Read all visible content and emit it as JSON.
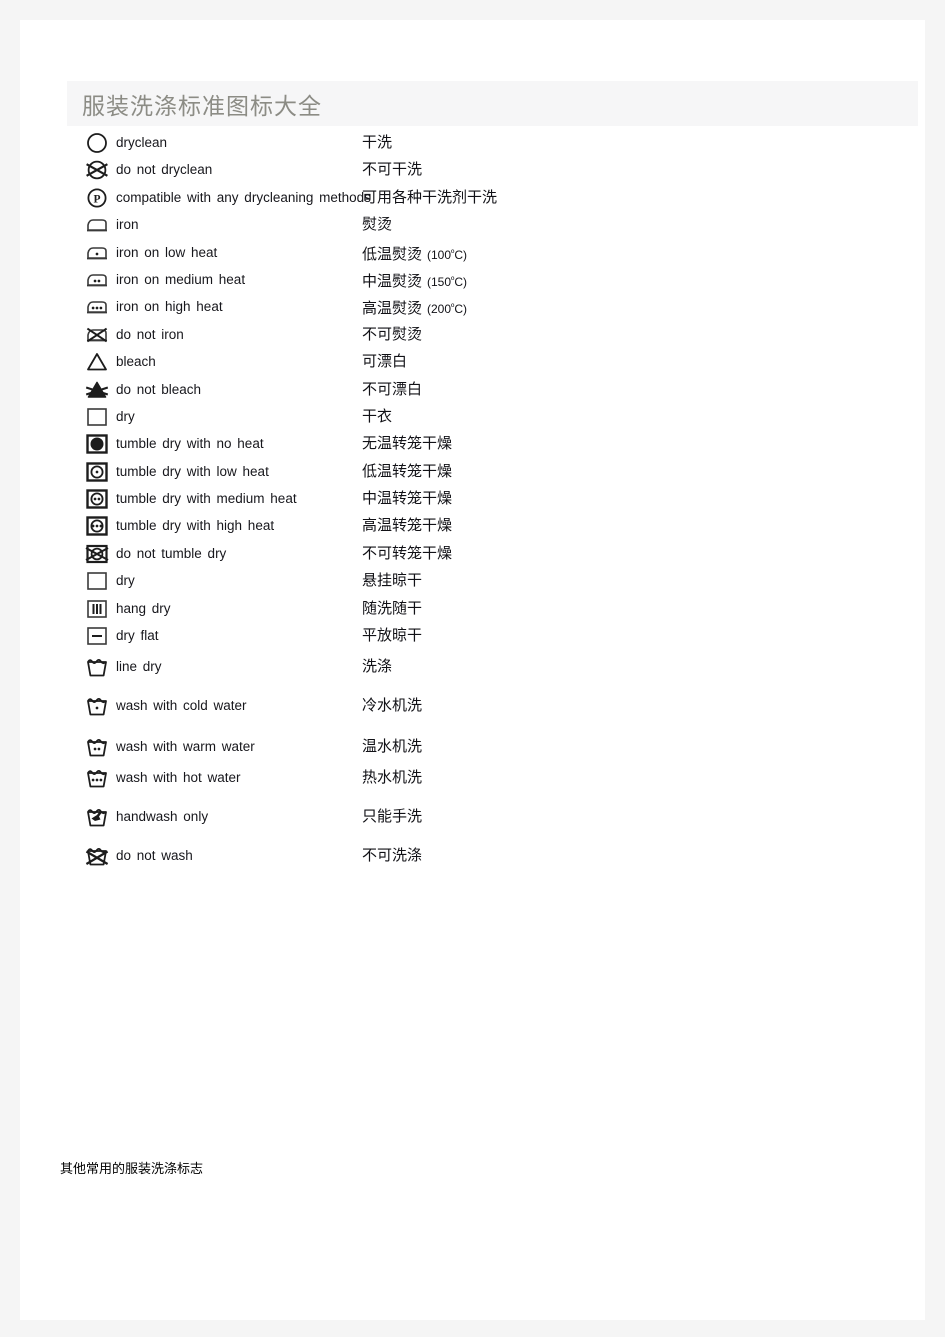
{
  "page": {
    "title": "服装洗涤标准图标大全",
    "footer_note": "其他常用的服装洗涤标志",
    "background_color": "#f5f5f5",
    "sheet_color": "#ffffff",
    "title_band_color": "#f6f6f7",
    "title_color": "#8c8c85"
  },
  "rows": [
    {
      "icon": "dryclean-circle-icon",
      "en": "dryclean",
      "zh": "干洗"
    },
    {
      "icon": "do-not-dryclean-circle-cross-icon",
      "en": "do not dryclean",
      "zh": "不可干洗"
    },
    {
      "icon": "dryclean-p-circle-icon",
      "en": "compatible with any drycleaning methods",
      "zh": "可用各种干洗剂干洗"
    },
    {
      "icon": "iron-icon",
      "en": "iron",
      "zh": "熨烫"
    },
    {
      "icon": "iron-one-dot-icon",
      "en": "iron on low heat",
      "zh": "低温熨烫",
      "temp": "(100ºC)"
    },
    {
      "icon": "iron-two-dot-icon",
      "en": "iron on medium heat",
      "zh": "中温熨烫",
      "temp": "(150ºC)"
    },
    {
      "icon": "iron-three-dot-icon",
      "en": "iron on high heat",
      "zh": "高温熨烫",
      "temp": "(200ºC)"
    },
    {
      "icon": "do-not-iron-icon",
      "en": "do not iron",
      "zh": "不可熨烫"
    },
    {
      "icon": "bleach-triangle-icon",
      "en": "bleach",
      "zh": "可漂白"
    },
    {
      "icon": "do-not-bleach-filled-triangle-icon",
      "en": "do not bleach",
      "zh": "不可漂白"
    },
    {
      "icon": "dry-square-icon",
      "en": "dry",
      "zh": "干衣"
    },
    {
      "icon": "tumble-dry-no-heat-icon",
      "en": "tumble dry with no heat",
      "zh": "无温转笼干燥"
    },
    {
      "icon": "tumble-dry-low-heat-icon",
      "en": "tumble dry with low heat",
      "zh": "低温转笼干燥"
    },
    {
      "icon": "tumble-dry-medium-heat-icon",
      "en": "tumble dry with medium heat",
      "zh": "中温转笼干燥"
    },
    {
      "icon": "tumble-dry-high-heat-icon",
      "en": "tumble dry with high heat",
      "zh": "高温转笼干燥"
    },
    {
      "icon": "do-not-tumble-dry-icon",
      "en": "do not tumble dry",
      "zh": "不可转笼干燥"
    },
    {
      "icon": "dry-square-icon",
      "en": "dry",
      "zh": "悬挂晾干"
    },
    {
      "icon": "hang-dry-icon",
      "en": "hang dry",
      "zh": "随洗随干"
    },
    {
      "icon": "dry-flat-icon",
      "en": "dry flat",
      "zh": "平放晾干"
    },
    {
      "icon": "wash-tub-icon",
      "en": "line dry",
      "zh": "洗涤"
    },
    {
      "icon": "wash-cold-icon",
      "en": "wash with cold water",
      "zh": "冷水机洗"
    },
    {
      "icon": "wash-warm-icon",
      "en": "wash with warm water",
      "zh": "温水机洗"
    },
    {
      "icon": "wash-hot-icon",
      "en": "wash with hot water",
      "zh": "热水机洗"
    },
    {
      "icon": "handwash-icon",
      "en": "handwash only",
      "zh": "只能手洗"
    },
    {
      "icon": "do-not-wash-icon",
      "en": "do not wash",
      "zh": "不可洗涤"
    }
  ]
}
